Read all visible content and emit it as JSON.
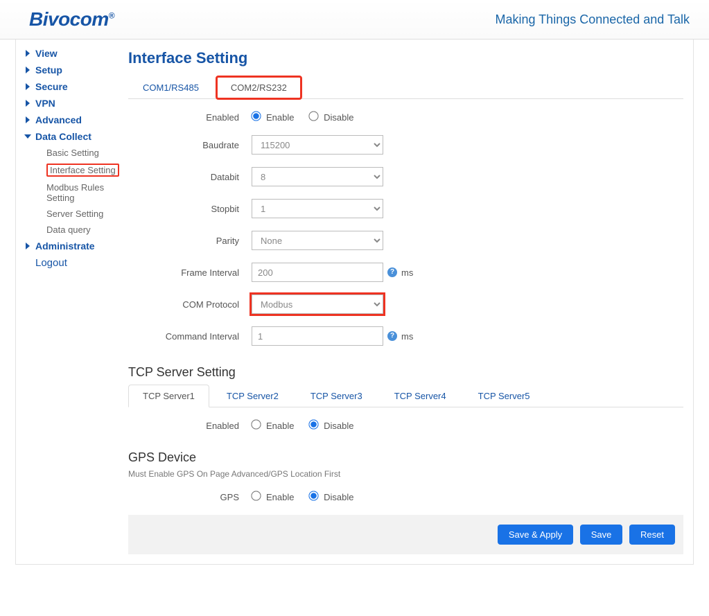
{
  "header": {
    "logo_text": "Bivocom",
    "tagline": "Making Things Connected and Talk"
  },
  "sidebar": {
    "items": [
      {
        "label": "View",
        "expanded": false
      },
      {
        "label": "Setup",
        "expanded": false
      },
      {
        "label": "Secure",
        "expanded": false
      },
      {
        "label": "VPN",
        "expanded": false
      },
      {
        "label": "Advanced",
        "expanded": false
      },
      {
        "label": "Data Collect",
        "expanded": true,
        "sub": [
          {
            "label": "Basic Setting"
          },
          {
            "label": "Interface Setting",
            "highlighted": true
          },
          {
            "label": "Modbus Rules Setting"
          },
          {
            "label": "Server Setting"
          },
          {
            "label": "Data query"
          }
        ]
      },
      {
        "label": "Administrate",
        "expanded": false
      }
    ],
    "logout": "Logout"
  },
  "main": {
    "page_title": "Interface Setting",
    "com_tabs": [
      {
        "label": "COM1/RS485",
        "active": false
      },
      {
        "label": "COM2/RS232",
        "active": true,
        "highlighted": true
      }
    ],
    "form": {
      "enabled": {
        "label": "Enabled",
        "option_enable": "Enable",
        "option_disable": "Disable",
        "value": "enable"
      },
      "baudrate": {
        "label": "Baudrate",
        "value": "115200"
      },
      "databit": {
        "label": "Databit",
        "value": "8"
      },
      "stopbit": {
        "label": "Stopbit",
        "value": "1"
      },
      "parity": {
        "label": "Parity",
        "value": "None"
      },
      "frame_interval": {
        "label": "Frame Interval",
        "value": "200",
        "unit": "ms"
      },
      "com_protocol": {
        "label": "COM Protocol",
        "value": "Modbus"
      },
      "command_interval": {
        "label": "Command Interval",
        "value": "1",
        "unit": "ms"
      }
    },
    "tcp": {
      "title": "TCP Server Setting",
      "tabs": [
        {
          "label": "TCP Server1",
          "active": true
        },
        {
          "label": "TCP Server2"
        },
        {
          "label": "TCP Server3"
        },
        {
          "label": "TCP Server4"
        },
        {
          "label": "TCP Server5"
        }
      ],
      "enabled": {
        "label": "Enabled",
        "option_enable": "Enable",
        "option_disable": "Disable",
        "value": "disable"
      }
    },
    "gps": {
      "title": "GPS Device",
      "sub": "Must Enable GPS On Page Advanced/GPS Location First",
      "label": "GPS",
      "option_enable": "Enable",
      "option_disable": "Disable",
      "value": "disable"
    },
    "buttons": {
      "save_apply": "Save & Apply",
      "save": "Save",
      "reset": "Reset"
    }
  }
}
